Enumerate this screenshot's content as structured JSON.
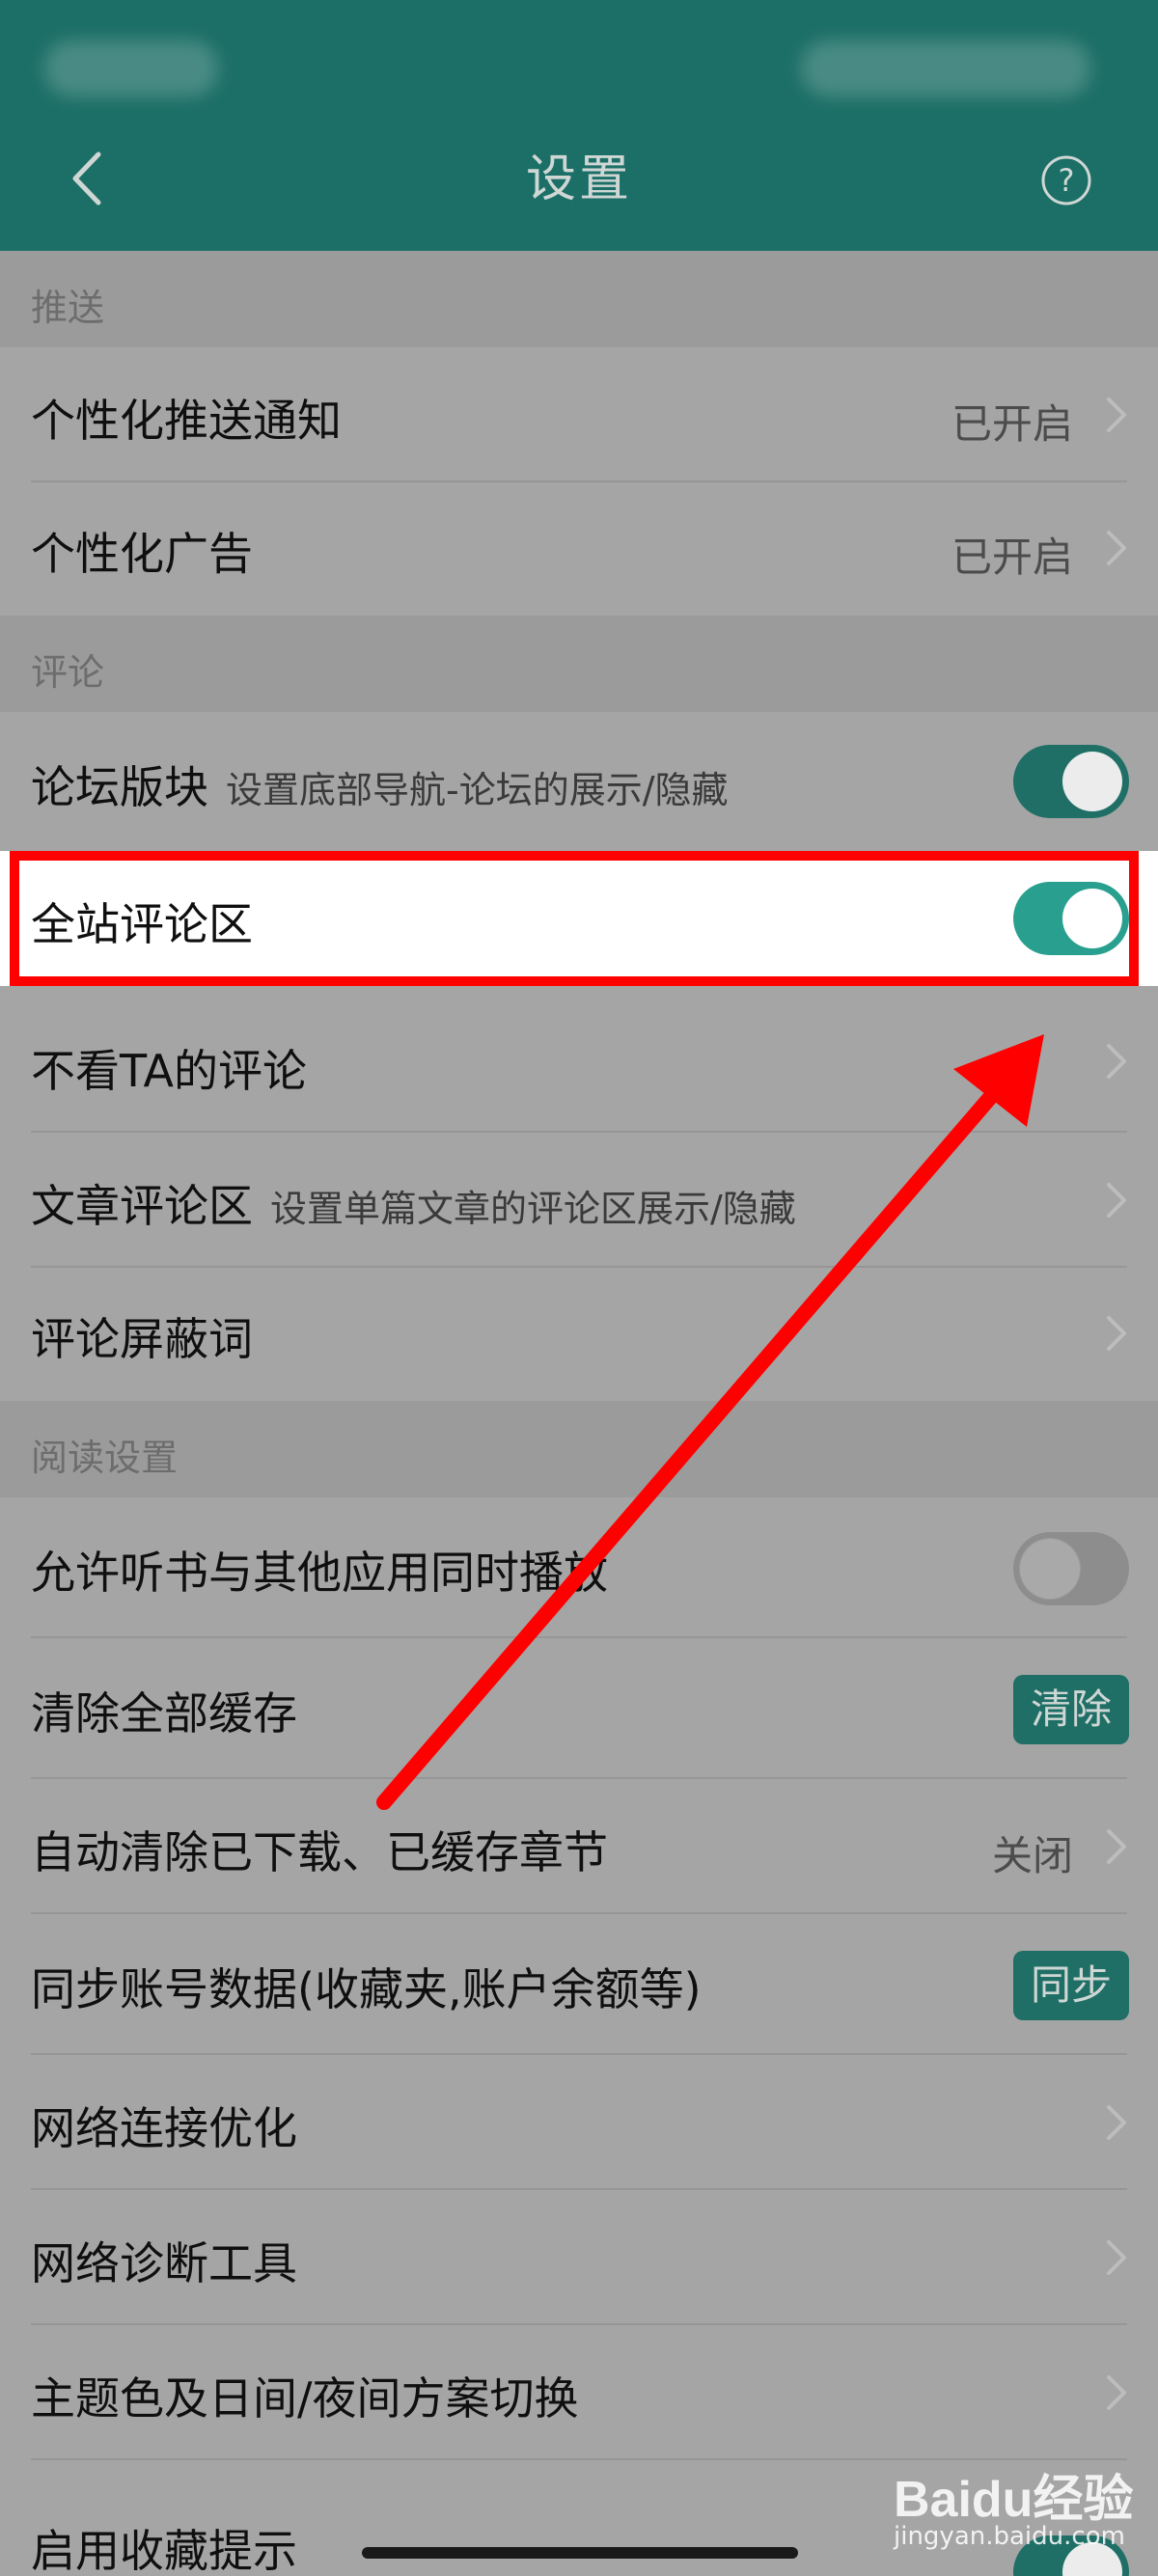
{
  "header": {
    "title": "设置"
  },
  "sections": {
    "push": "推送",
    "comments": "评论",
    "reading": "阅读设置"
  },
  "rows": {
    "personalized_push": {
      "label": "个性化推送通知",
      "value": "已开启"
    },
    "personalized_ads": {
      "label": "个性化广告",
      "value": "已开启"
    },
    "forum_block": {
      "label": "论坛版块",
      "sub": "设置底部导航-论坛的展示/隐藏",
      "toggle": "on"
    },
    "global_comments": {
      "label": "全站评论区",
      "toggle": "on"
    },
    "hide_ta_comments": {
      "label": "不看TA的评论"
    },
    "article_comments": {
      "label": "文章评论区",
      "sub": "设置单篇文章的评论区展示/隐藏"
    },
    "comment_block_words": {
      "label": "评论屏蔽词"
    },
    "allow_audio_mix": {
      "label": "允许听书与其他应用同时播放",
      "toggle": "off"
    },
    "clear_cache": {
      "label": "清除全部缓存",
      "button": "清除"
    },
    "auto_clear": {
      "label": "自动清除已下载、已缓存章节",
      "value": "关闭"
    },
    "sync_account": {
      "label": "同步账号数据(收藏夹,账户余额等)",
      "button": "同步"
    },
    "network_optimize": {
      "label": "网络连接优化"
    },
    "network_diagnose": {
      "label": "网络诊断工具"
    },
    "theme_switch": {
      "label": "主题色及日间/夜间方案切换"
    },
    "favorite_tip": {
      "label": "启用收藏提示"
    }
  },
  "watermark": {
    "brand": "Baidu经验",
    "url": "jingyan.baidu.com"
  },
  "colors": {
    "header_bg": "#1c6f66",
    "accent": "#1f6f66",
    "highlight": "#ff0000"
  }
}
